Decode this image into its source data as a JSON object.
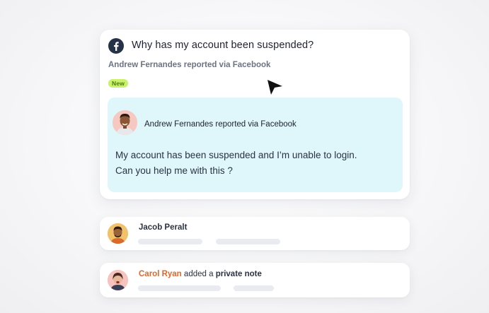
{
  "ticket": {
    "title": "Why has my account been suspended?",
    "subtitle": "Andrew Fernandes reported via Facebook",
    "badge": "New",
    "source_icon": "facebook-icon",
    "message": {
      "author_line": "Andrew Fernandes reported via Facebook",
      "line1": "My account has been suspended and I’m unable to login.",
      "line2": "Can you help me with this ?"
    }
  },
  "activity": [
    {
      "name": "Jacob Peralt"
    },
    {
      "name": "Carol Ryan",
      "action_prefix": "added a",
      "action_bold": "private note"
    }
  ],
  "colors": {
    "message_bg": "#dff6fb",
    "badge_bg": "#c8f26a",
    "badge_text": "#4c7a12",
    "accent_name": "#e2662a",
    "facebook_icon_bg": "#263246"
  }
}
